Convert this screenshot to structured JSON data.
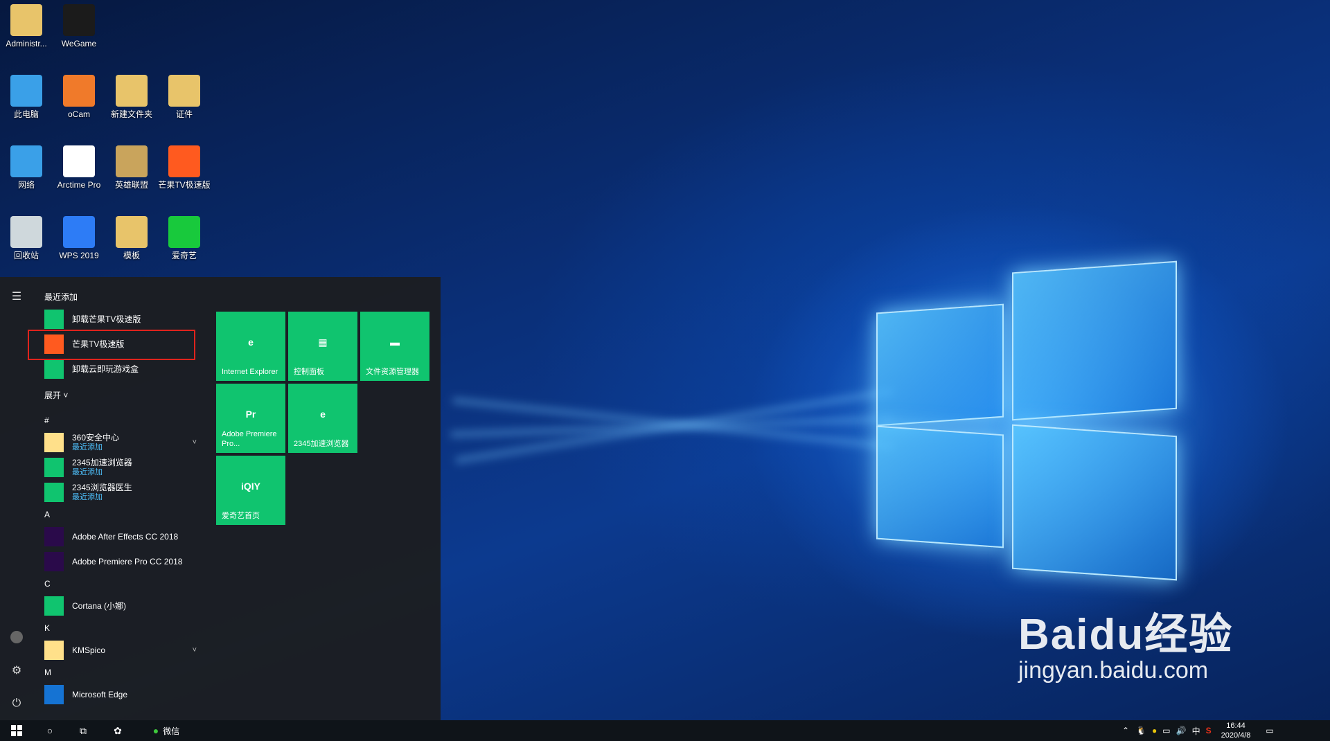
{
  "desktop_icons": [
    {
      "label": "Administr...",
      "icon": "user-folder-icon",
      "color": "#e8c46a"
    },
    {
      "label": "WeGame",
      "icon": "wegame-icon",
      "color": "#1b1b1b"
    },
    {
      "label": "此电脑",
      "icon": "computer-icon",
      "color": "#3aa0e8"
    },
    {
      "label": "oCam",
      "icon": "ocam-icon",
      "color": "#f07a2a"
    },
    {
      "label": "新建文件夹",
      "icon": "folder-icon",
      "color": "#e8c46a"
    },
    {
      "label": "证件",
      "icon": "folder-icon",
      "color": "#e8c46a"
    },
    {
      "label": "网络",
      "icon": "network-icon",
      "color": "#3aa0e8"
    },
    {
      "label": "Arctime Pro",
      "icon": "arctime-icon",
      "color": "#ffffff"
    },
    {
      "label": "英雄联盟",
      "icon": "lol-icon",
      "color": "#c9a45c"
    },
    {
      "label": "芒果TV极速版",
      "icon": "mgtv-icon",
      "color": "#ff5a1f"
    },
    {
      "label": "回收站",
      "icon": "recycle-bin-icon",
      "color": "#cfd8dc"
    },
    {
      "label": "WPS 2019",
      "icon": "wps-icon",
      "color": "#2d7cf6"
    },
    {
      "label": "模板",
      "icon": "folder-icon",
      "color": "#e8c46a"
    },
    {
      "label": "爱奇艺",
      "icon": "iqiyi-icon",
      "color": "#18c93c"
    }
  ],
  "start_menu": {
    "recent_header": "最近添加",
    "recent": [
      {
        "label": "卸载芒果TV极速版",
        "icon": "uninstall-icon"
      },
      {
        "label": "芒果TV极速版",
        "icon": "mgtv-icon"
      },
      {
        "label": "卸载云即玩游戏盒",
        "icon": "uninstall-icon"
      }
    ],
    "expand_label": "展开 ˅",
    "sections": [
      {
        "letter": "#",
        "apps": [
          {
            "label": "360安全中心",
            "sub": "最近添加",
            "icon": "folder-icon",
            "chevron": true
          },
          {
            "label": "2345加速浏览器",
            "sub": "最近添加",
            "icon": "2345-browser-icon"
          },
          {
            "label": "2345浏览器医生",
            "sub": "最近添加",
            "icon": "doctor-icon"
          }
        ]
      },
      {
        "letter": "A",
        "apps": [
          {
            "label": "Adobe After Effects CC 2018",
            "icon": "ae-icon"
          },
          {
            "label": "Adobe Premiere Pro CC 2018",
            "icon": "pr-icon"
          }
        ]
      },
      {
        "letter": "C",
        "apps": [
          {
            "label": "Cortana (小娜)",
            "icon": "cortana-icon"
          }
        ]
      },
      {
        "letter": "K",
        "apps": [
          {
            "label": "KMSpico",
            "icon": "folder-icon",
            "chevron": true
          }
        ]
      },
      {
        "letter": "M",
        "apps": [
          {
            "label": "Microsoft Edge",
            "icon": "edge-icon"
          }
        ]
      }
    ],
    "tiles": [
      {
        "label": "Internet Explorer",
        "icon": "ie-icon",
        "glyph": "e"
      },
      {
        "label": "控制面板",
        "icon": "control-panel-icon",
        "glyph": "▦"
      },
      {
        "label": "文件资源管理器",
        "icon": "file-explorer-icon",
        "glyph": "▬"
      },
      {
        "label": "Adobe Premiere Pro...",
        "icon": "pr-icon",
        "glyph": "Pr"
      },
      {
        "label": "2345加速浏览器",
        "icon": "2345-browser-icon",
        "glyph": "e"
      },
      {
        "label": "爱奇艺首页",
        "icon": "iqiyi-icon",
        "glyph": "iQIY"
      }
    ]
  },
  "taskbar": {
    "wechat_label": "微信",
    "ime": "中",
    "time": "16:44",
    "date": "2020/4/8"
  },
  "watermark": {
    "main": "Baidu经验",
    "sub": "jingyan.baidu.com"
  }
}
